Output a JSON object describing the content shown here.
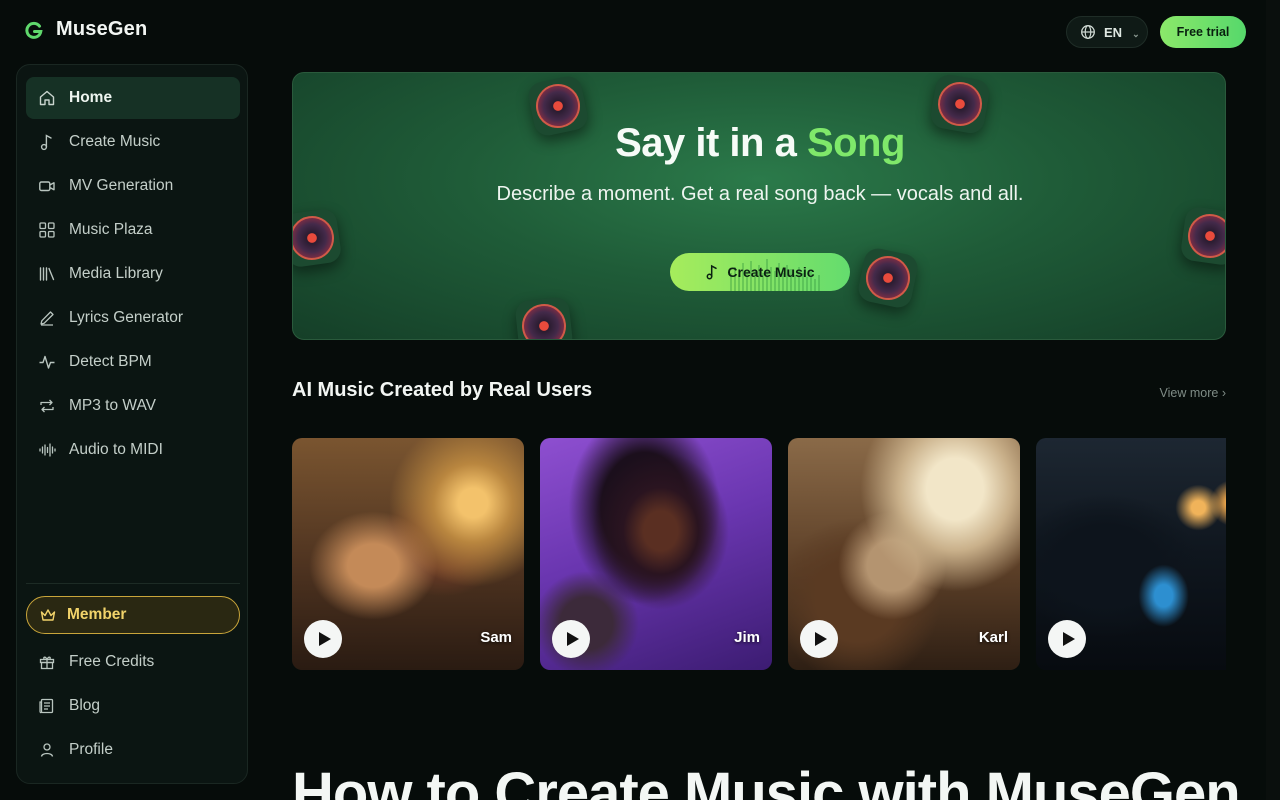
{
  "brand": {
    "name": "MuseGen",
    "accent": "#6fe06a"
  },
  "topbar": {
    "language": "EN",
    "trial_label": "Free trial"
  },
  "sidebar": {
    "items": [
      {
        "label": "Home",
        "icon": "home-icon",
        "active": true
      },
      {
        "label": "Create Music",
        "icon": "music-note-icon"
      },
      {
        "label": "MV Generation",
        "icon": "video-camera-icon"
      },
      {
        "label": "Music Plaza",
        "icon": "grid-icon"
      },
      {
        "label": "Media Library",
        "icon": "library-icon"
      },
      {
        "label": "Lyrics Generator",
        "icon": "pen-icon"
      },
      {
        "label": "Detect BPM",
        "icon": "pulse-icon"
      },
      {
        "label": "MP3 to WAV",
        "icon": "convert-icon"
      },
      {
        "label": "Audio to MIDI",
        "icon": "waveform-icon"
      }
    ],
    "member_label": "Member",
    "bottom_items": [
      {
        "label": "Free Credits",
        "icon": "gift-icon"
      },
      {
        "label": "Blog",
        "icon": "newspaper-icon"
      },
      {
        "label": "Profile",
        "icon": "user-icon"
      }
    ]
  },
  "hero": {
    "title_prefix": "Say it in a ",
    "title_accent": "Song",
    "subtitle": "Describe a moment. Get a real song back — vocals and all.",
    "cta_label": "Create Music"
  },
  "showcase": {
    "title": "AI Music Created by Real Users",
    "view_more": "View more ›",
    "cards": [
      {
        "name": "Sam",
        "theme": "couple-vinyl"
      },
      {
        "name": "Jim",
        "theme": "singer-purple"
      },
      {
        "name": "Karl",
        "theme": "piano-duo"
      },
      {
        "name": "",
        "theme": "night-drive"
      }
    ]
  },
  "howto_heading": "How to Create Music with MuseGen"
}
